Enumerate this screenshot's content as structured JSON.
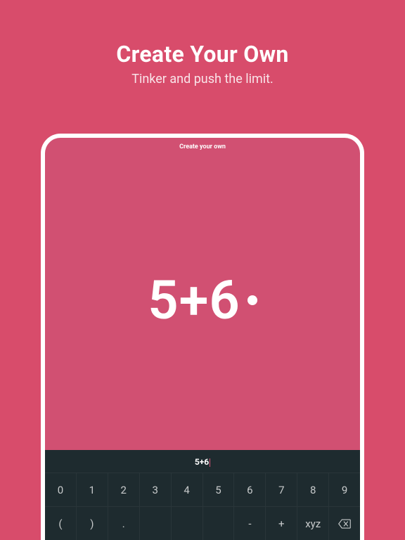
{
  "header": {
    "title": "Create Your Own",
    "subtitle": "Tinker and push the limit."
  },
  "device": {
    "title": "Create your own",
    "corner_left": "",
    "corner_right": "",
    "expression": "5+6",
    "input_preview": "5+6"
  },
  "keyboard": {
    "row1": [
      "0",
      "1",
      "2",
      "3",
      "4",
      "5",
      "6",
      "7",
      "8",
      "9"
    ],
    "row2": [
      "(",
      ")",
      ".",
      "",
      "",
      "",
      "-",
      "+",
      "xyz",
      "⌫"
    ]
  }
}
